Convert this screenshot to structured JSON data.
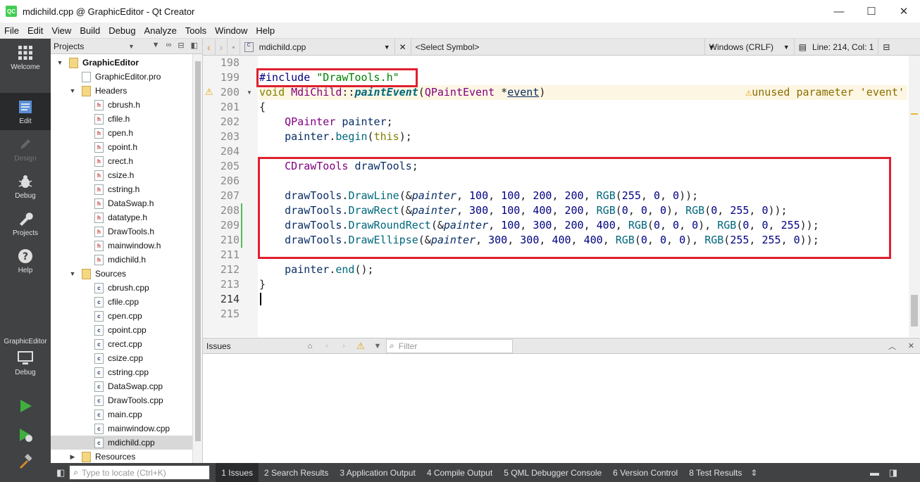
{
  "window": {
    "title": "mdichild.cpp @ GraphicEditor - Qt Creator",
    "app_icon": "QC",
    "minimize": "—",
    "maximize": "☐",
    "close": "✕"
  },
  "menu": [
    "File",
    "Edit",
    "View",
    "Build",
    "Debug",
    "Analyze",
    "Tools",
    "Window",
    "Help"
  ],
  "modes": [
    {
      "label": "Welcome",
      "icon": "grid-icon"
    },
    {
      "label": "Edit",
      "icon": "document-icon"
    },
    {
      "label": "Design",
      "icon": "pencil-icon"
    },
    {
      "label": "Debug",
      "icon": "bug-icon"
    },
    {
      "label": "Projects",
      "icon": "wrench-icon"
    },
    {
      "label": "Help",
      "icon": "help-icon"
    }
  ],
  "target": {
    "project": "GraphicEditor",
    "mode": "Debug"
  },
  "navigator": {
    "title": "Projects",
    "tree": [
      {
        "label": "GraphicEditor",
        "level": 0,
        "kind": "project",
        "expanded": true
      },
      {
        "label": "GraphicEditor.pro",
        "level": 1,
        "kind": "pro"
      },
      {
        "label": "Headers",
        "level": 1,
        "kind": "folder",
        "expanded": true
      },
      {
        "label": "cbrush.h",
        "level": 2,
        "kind": "h"
      },
      {
        "label": "cfile.h",
        "level": 2,
        "kind": "h"
      },
      {
        "label": "cpen.h",
        "level": 2,
        "kind": "h"
      },
      {
        "label": "cpoint.h",
        "level": 2,
        "kind": "h"
      },
      {
        "label": "crect.h",
        "level": 2,
        "kind": "h"
      },
      {
        "label": "csize.h",
        "level": 2,
        "kind": "h"
      },
      {
        "label": "cstring.h",
        "level": 2,
        "kind": "h"
      },
      {
        "label": "DataSwap.h",
        "level": 2,
        "kind": "h"
      },
      {
        "label": "datatype.h",
        "level": 2,
        "kind": "h"
      },
      {
        "label": "DrawTools.h",
        "level": 2,
        "kind": "h"
      },
      {
        "label": "mainwindow.h",
        "level": 2,
        "kind": "h"
      },
      {
        "label": "mdichild.h",
        "level": 2,
        "kind": "h"
      },
      {
        "label": "Sources",
        "level": 1,
        "kind": "folder",
        "expanded": true
      },
      {
        "label": "cbrush.cpp",
        "level": 2,
        "kind": "cpp"
      },
      {
        "label": "cfile.cpp",
        "level": 2,
        "kind": "cpp"
      },
      {
        "label": "cpen.cpp",
        "level": 2,
        "kind": "cpp"
      },
      {
        "label": "cpoint.cpp",
        "level": 2,
        "kind": "cpp"
      },
      {
        "label": "crect.cpp",
        "level": 2,
        "kind": "cpp"
      },
      {
        "label": "csize.cpp",
        "level": 2,
        "kind": "cpp"
      },
      {
        "label": "cstring.cpp",
        "level": 2,
        "kind": "cpp"
      },
      {
        "label": "DataSwap.cpp",
        "level": 2,
        "kind": "cpp"
      },
      {
        "label": "DrawTools.cpp",
        "level": 2,
        "kind": "cpp"
      },
      {
        "label": "main.cpp",
        "level": 2,
        "kind": "cpp"
      },
      {
        "label": "mainwindow.cpp",
        "level": 2,
        "kind": "cpp"
      },
      {
        "label": "mdichild.cpp",
        "level": 2,
        "kind": "cpp",
        "selected": true
      },
      {
        "label": "Resources",
        "level": 1,
        "kind": "folder",
        "expanded": false
      }
    ]
  },
  "editor_toolbar": {
    "file": "mdichild.cpp",
    "symbol": "<Select Symbol>",
    "line_ending": "Windows (CRLF)",
    "position": "Line: 214, Col: 1"
  },
  "editor": {
    "line_numbers": [
      "198",
      "199",
      "200",
      "201",
      "202",
      "203",
      "204",
      "205",
      "206",
      "207",
      "208",
      "209",
      "210",
      "211",
      "212",
      "213",
      "214",
      "215"
    ],
    "current_line": "214",
    "warning": "unused parameter 'event'"
  },
  "issues": {
    "title": "Issues",
    "filter_placeholder": "Filter"
  },
  "statusbar": {
    "locator_placeholder": "Type to locate (Ctrl+K)",
    "tabs": [
      "1  Issues",
      "2  Search Results",
      "3  Application Output",
      "4  Compile Output",
      "5  QML Debugger Console",
      "6  Version Control",
      "8  Test Results"
    ]
  },
  "colors": {
    "highlight_box": "#e0202e",
    "mode_bar": "#404244"
  }
}
